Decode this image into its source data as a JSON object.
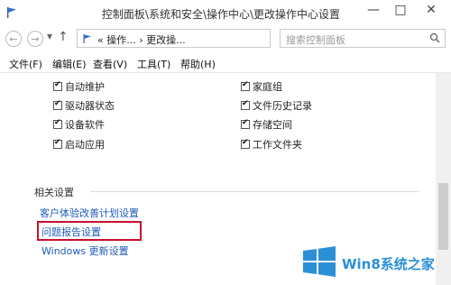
{
  "window": {
    "title": "控制面板\\系统和安全\\操作中心\\更改操作中心设置",
    "minimize_glyph": "—",
    "maximize_glyph": "□",
    "close_glyph": "✕"
  },
  "addressbar": {
    "back_glyph": "←",
    "forward_glyph": "→",
    "up_glyph": "↑",
    "path": "« 操作... › 更改操...",
    "refresh_glyph": "↻",
    "search_placeholder": "搜索控制面板"
  },
  "menu": {
    "items": [
      "文件(F)",
      "编辑(E)",
      "查看(V)",
      "工具(T)",
      "帮助(H)"
    ]
  },
  "maintenance_checks": {
    "left": [
      {
        "label": "自动维护",
        "checked": true
      },
      {
        "label": "驱动器状态",
        "checked": true
      },
      {
        "label": "设备软件",
        "checked": true
      },
      {
        "label": "启动应用",
        "checked": true
      }
    ],
    "right": [
      {
        "label": "家庭组",
        "checked": true
      },
      {
        "label": "文件历史记录",
        "checked": true
      },
      {
        "label": "存储空间",
        "checked": true
      },
      {
        "label": "工作文件夹",
        "checked": true
      }
    ]
  },
  "related": {
    "title": "相关设置",
    "links": [
      "客户体验改善计划设置",
      "问题报告设置",
      "Windows 更新设置"
    ]
  },
  "watermark": {
    "text": "Win8系统之家"
  },
  "colors": {
    "link": "#1e5bb8",
    "highlight": "#c8102e",
    "watermark": "#2b8fd6"
  }
}
